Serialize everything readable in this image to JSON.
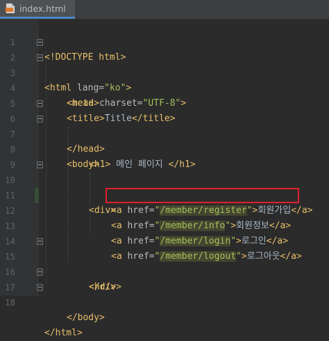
{
  "tab": {
    "label": "index.html",
    "icon": "html-file-icon",
    "accent": "#4a88c7"
  },
  "gutter": {
    "line_numbers": [
      "1",
      "2",
      "3",
      "4",
      "5",
      "6",
      "7",
      "8",
      "9",
      "10",
      "11",
      "12",
      "13",
      "14",
      "15",
      "16",
      "17",
      "18"
    ]
  },
  "code": {
    "l1": "<!DOCTYPE html>",
    "l2": {
      "open": "<html ",
      "attr": "lang=",
      "val": "\"ko\"",
      "close": ">"
    },
    "l3": "<head>",
    "l4": {
      "open": "<meta ",
      "attr": "charset=",
      "val": "\"UTF-8\"",
      "close": ">"
    },
    "l5": {
      "open": "<title>",
      "text": "Title",
      "close": "</title>"
    },
    "l6": "</head>",
    "l7": "<body>",
    "l8": {
      "open": "<h1>",
      "text": " 메인 페이지 ",
      "close": "</h1>"
    },
    "l10": "<div>",
    "l11": {
      "open": "<a ",
      "attr": "href=",
      "q1": "\"",
      "path": "/member/register",
      "q2": "\"",
      "gt": ">",
      "text": "회원가입",
      "close": "</a>"
    },
    "l12": {
      "open": "<a ",
      "attr": "href=",
      "q1": "\"",
      "path": "/member/info",
      "q2": "\"",
      "gt": ">",
      "text": "회원정보",
      "close": "</a>"
    },
    "l13": {
      "open": "<a ",
      "attr": "href=",
      "q1": "\"",
      "path": "/member/login",
      "q2": "\"",
      "gt": ">",
      "text": "로그인",
      "close": "</a>"
    },
    "l14": {
      "open": "<a ",
      "attr": "href=",
      "q1": "\"",
      "path": "/member/logout",
      "q2": "\"",
      "gt": ">",
      "text": "로그아웃",
      "close": "</a>"
    },
    "l15": "</div>",
    "l16": "<hr/>",
    "l17": "</body>",
    "l18": "</html>"
  },
  "colors": {
    "background": "#2b2b2b",
    "tag": "#e8bf6a",
    "attribute": "#bababa",
    "string": "#a5c25c",
    "text": "#a9b7c6",
    "line_number": "#606366",
    "highlight_box": "#e0212a"
  }
}
